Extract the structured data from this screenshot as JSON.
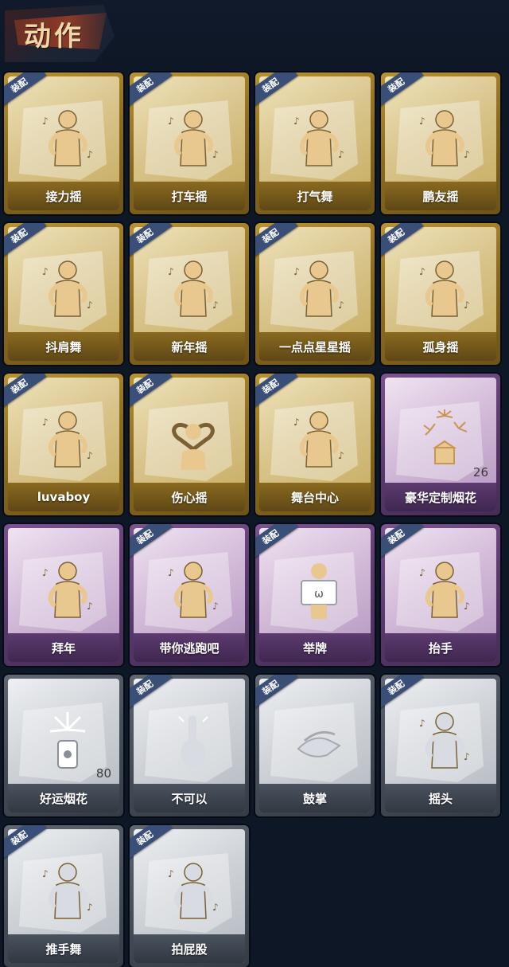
{
  "header": {
    "title": "动作"
  },
  "badge_label": "装配",
  "colors": {
    "gold": "#d8c48b",
    "purple": "#d3bbd9",
    "silver": "#cfd3d8",
    "badge": "#3a4f78"
  },
  "cards": [
    {
      "label": "接力摇",
      "tier": "gold",
      "equipped": true,
      "icon": "figure-shaking-icon"
    },
    {
      "label": "打车摇",
      "tier": "gold",
      "equipped": true,
      "icon": "figure-shaking-icon"
    },
    {
      "label": "打气舞",
      "tier": "gold",
      "equipped": true,
      "icon": "figure-dancing-icon"
    },
    {
      "label": "鹏友摇",
      "tier": "gold",
      "equipped": true,
      "icon": "figure-shaking-icon"
    },
    {
      "label": "抖肩舞",
      "tier": "gold",
      "equipped": true,
      "icon": "figure-shoulder-icon"
    },
    {
      "label": "新年摇",
      "tier": "gold",
      "equipped": true,
      "icon": "figure-shaking-icon"
    },
    {
      "label": "一点点星星摇",
      "tier": "gold",
      "equipped": true,
      "icon": "figure-sparkle-icon"
    },
    {
      "label": "孤身摇",
      "tier": "gold",
      "equipped": true,
      "icon": "figure-shaking-icon"
    },
    {
      "label": "luvaboy",
      "tier": "gold",
      "equipped": true,
      "icon": "figure-dancing-icon"
    },
    {
      "label": "伤心摇",
      "tier": "gold",
      "equipped": true,
      "icon": "figure-heart-icon"
    },
    {
      "label": "舞台中心",
      "tier": "gold",
      "equipped": true,
      "icon": "figure-sparkle-icon"
    },
    {
      "label": "豪华定制烟花",
      "tier": "purple",
      "equipped": false,
      "icon": "fireworks-box-icon",
      "count": "26"
    },
    {
      "label": "拜年",
      "tier": "purple",
      "equipped": false,
      "icon": "figure-bow-icon"
    },
    {
      "label": "带你逃跑吧",
      "tier": "purple",
      "equipped": true,
      "icon": "figure-running-icon"
    },
    {
      "label": "举牌",
      "tier": "purple",
      "equipped": true,
      "icon": "sign-holding-icon"
    },
    {
      "label": "抬手",
      "tier": "purple",
      "equipped": true,
      "icon": "figure-raise-hand-icon"
    },
    {
      "label": "好运烟花",
      "tier": "silver",
      "equipped": false,
      "icon": "firework-canister-icon",
      "count": "80"
    },
    {
      "label": "不可以",
      "tier": "silver",
      "equipped": true,
      "icon": "finger-no-icon"
    },
    {
      "label": "鼓掌",
      "tier": "silver",
      "equipped": true,
      "icon": "clapping-hands-icon"
    },
    {
      "label": "摇头",
      "tier": "silver",
      "equipped": true,
      "icon": "figure-head-shake-icon"
    },
    {
      "label": "推手舞",
      "tier": "silver",
      "equipped": true,
      "icon": "figure-push-icon"
    },
    {
      "label": "拍屁股",
      "tier": "silver",
      "equipped": true,
      "icon": "figure-slap-icon"
    }
  ]
}
